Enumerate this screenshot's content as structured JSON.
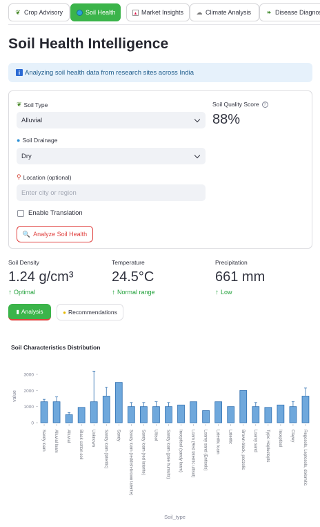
{
  "tabs": [
    {
      "label": "Crop Advisory",
      "icon": "seedling-icon",
      "active": false
    },
    {
      "label": "Soil Health",
      "icon": "globe-icon",
      "active": true
    },
    {
      "label": "Market Insights",
      "icon": "chart-icon",
      "active": false
    },
    {
      "label": "Climate Analysis",
      "icon": "cloud-icon",
      "active": false
    },
    {
      "label": "Disease Diagnosis",
      "icon": "leaf-icon",
      "active": false
    }
  ],
  "page_title": "Soil Health Intelligence",
  "info_message": "Analyzing soil health data from research sites across India",
  "form": {
    "soil_type_label": "Soil Type",
    "soil_type_value": "Alluvial",
    "soil_drainage_label": "Soil Drainage",
    "soil_drainage_value": "Dry",
    "location_label": "Location (optional)",
    "location_placeholder": "Enter city or region",
    "translation_label": "Enable Translation",
    "analyze_button": "Analyze Soil Health",
    "quality_label": "Soil Quality Score",
    "quality_value": "88%"
  },
  "metrics": [
    {
      "label": "Soil Density",
      "value": "1.24 g/cm³",
      "delta": "Optimal"
    },
    {
      "label": "Temperature",
      "value": "24.5°C",
      "delta": "Normal range"
    },
    {
      "label": "Precipitation",
      "value": "661 mm",
      "delta": "Low"
    }
  ],
  "subtabs": {
    "analysis": "Analysis",
    "recommendations": "Recommendations"
  },
  "chart_title": "Soil Characteristics Distribution",
  "colors": {
    "accent_green": "#3bb44a",
    "danger_red": "#e0413f",
    "delta_green": "#21a13a",
    "bar_fill": "#6fa8dc",
    "bar_stroke": "#2f6fb0"
  },
  "chart_data": {
    "type": "bar",
    "xlabel": "Soil_type",
    "ylabel": "value",
    "ylim": [
      0,
      3300
    ],
    "yticks": [
      0,
      1000,
      2000,
      3000
    ],
    "categories": [
      "Sandy loam",
      "Alluvial loam",
      "Alluvial",
      "Black cotton soil",
      "Unknown",
      "Sandy loam (lateritic)",
      "Sandy",
      "Sandy loam (reddish-brown laterite)",
      "Sandy loam (red laterite)",
      "Ultisol",
      "Sandy loam (pale humults)",
      "Inceptisol (sandy loam)",
      "Loam (Red lateritic ultisol)",
      "Loamy sand (Entisols)",
      "Lateritic loam",
      "Lateritic",
      "Brown-black, podzolic",
      "Loamy sand",
      "Typic Haplustepts",
      "Inceptisol",
      "Clayey",
      "Regosols, Leptosols, dolomitic"
    ],
    "values": [
      1300,
      1300,
      500,
      950,
      1300,
      1650,
      2500,
      1000,
      1000,
      1000,
      1000,
      1100,
      1300,
      750,
      1300,
      1000,
      2000,
      1000,
      950,
      1100,
      1000,
      1650
    ],
    "errors": [
      150,
      300,
      130,
      0,
      1900,
      550,
      0,
      250,
      250,
      300,
      250,
      0,
      0,
      0,
      0,
      0,
      0,
      250,
      0,
      0,
      300,
      500
    ]
  }
}
